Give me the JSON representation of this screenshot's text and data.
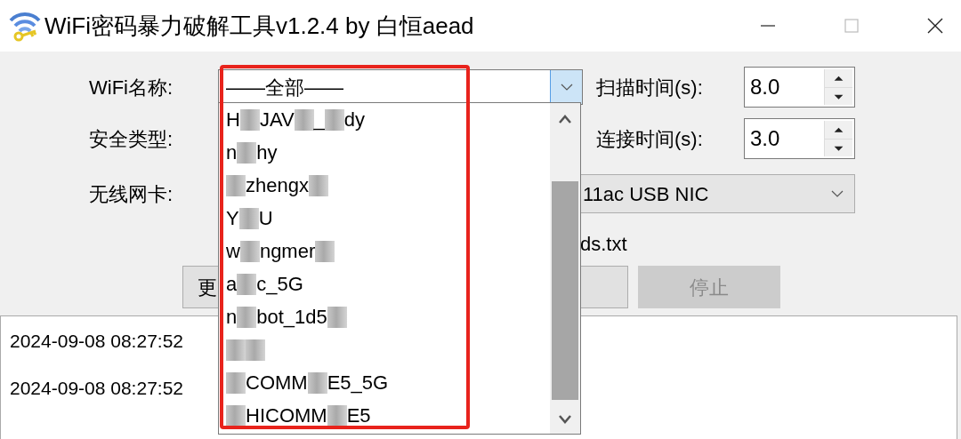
{
  "window": {
    "title": "WiFi密码暴力破解工具v1.2.4 by 白恒aead"
  },
  "form": {
    "wifi_name": {
      "label": "WiFi名称:",
      "value": "——全部——"
    },
    "security_type": {
      "label": "安全类型:"
    },
    "adapter": {
      "label": "无线网卡:",
      "value": "11ac USB NIC"
    },
    "dictionary": {
      "value": "ds.txt"
    }
  },
  "spinners": [
    {
      "label": "扫描时间(s):",
      "value": "8.0"
    },
    {
      "label": "连接时间(s):",
      "value": "3.0"
    }
  ],
  "buttons": [
    {
      "label": "更",
      "disabled": false
    },
    {
      "disabled": false
    },
    {
      "label": "停止",
      "disabled": true
    }
  ],
  "dropdown": {
    "open": true,
    "items": [
      {
        "parts": [
          {
            "kind": "text",
            "text": "H"
          },
          {
            "kind": "blur"
          },
          {
            "kind": "text",
            "text": "JAV"
          },
          {
            "kind": "blur"
          },
          {
            "kind": "text",
            "text": "_"
          },
          {
            "kind": "blur"
          },
          {
            "kind": "text",
            "text": "dy"
          }
        ]
      },
      {
        "parts": [
          {
            "kind": "text",
            "text": "n"
          },
          {
            "kind": "blur"
          },
          {
            "kind": "text",
            "text": "hy"
          }
        ]
      },
      {
        "parts": [
          {
            "kind": "blur"
          },
          {
            "kind": "text",
            "text": "zhengx"
          },
          {
            "kind": "blur"
          }
        ]
      },
      {
        "parts": [
          {
            "kind": "text",
            "text": "Y"
          },
          {
            "kind": "blur"
          },
          {
            "kind": "text",
            "text": "U"
          }
        ]
      },
      {
        "parts": [
          {
            "kind": "text",
            "text": "w"
          },
          {
            "kind": "blur"
          },
          {
            "kind": "text",
            "text": "ngmer"
          },
          {
            "kind": "blur"
          }
        ]
      },
      {
        "parts": [
          {
            "kind": "text",
            "text": "a"
          },
          {
            "kind": "blur"
          },
          {
            "kind": "text",
            "text": "c_5G"
          }
        ]
      },
      {
        "parts": [
          {
            "kind": "text",
            "text": "n"
          },
          {
            "kind": "blur"
          },
          {
            "kind": "text",
            "text": "bot_1d5"
          },
          {
            "kind": "blur"
          }
        ]
      },
      {
        "parts": [
          {
            "kind": "blur"
          },
          {
            "kind": "blur"
          }
        ]
      },
      {
        "parts": [
          {
            "kind": "blur"
          },
          {
            "kind": "text",
            "text": "COMM"
          },
          {
            "kind": "blur"
          },
          {
            "kind": "text",
            "text": "E5_5G"
          }
        ]
      },
      {
        "parts": [
          {
            "kind": "blur"
          },
          {
            "kind": "text",
            "text": "HICOMM"
          },
          {
            "kind": "blur"
          },
          {
            "kind": "text",
            "text": "E5"
          }
        ]
      }
    ]
  },
  "log": {
    "lines": [
      "2024-09-08 08:27:52",
      "2024-09-08 08:27:52"
    ]
  },
  "annotation": {
    "kind": "frame"
  }
}
